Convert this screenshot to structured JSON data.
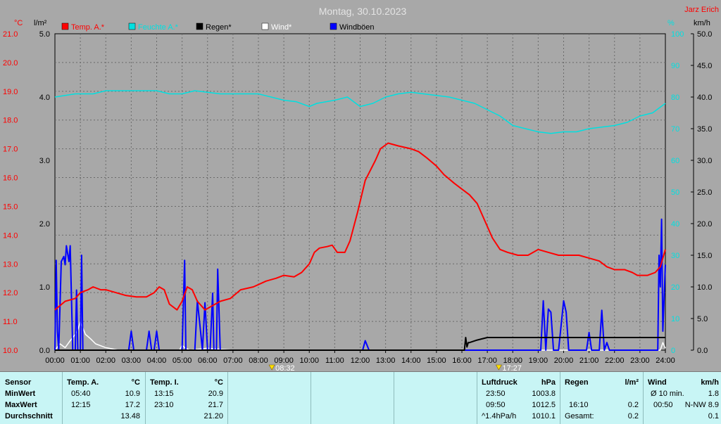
{
  "chart_data": {
    "type": "line",
    "title": "Montag, 30.10.2023",
    "brand": "Jarz Erich",
    "axes": {
      "temp": {
        "unit": "°C",
        "min": 10.0,
        "max": 21.0,
        "step": 1.0,
        "color": "#ff0000"
      },
      "rain": {
        "unit": "l/m²",
        "min": 0.0,
        "max": 5.0,
        "step": 1.0,
        "color": "#000000"
      },
      "humidity": {
        "unit": "%",
        "min": 0,
        "max": 100,
        "step": 10,
        "color": "#00e0e0"
      },
      "wind": {
        "unit": "km/h",
        "min": 0.0,
        "max": 50.0,
        "step": 5.0,
        "color": "#000000"
      }
    },
    "x_ticks": [
      "00:00",
      "01:00",
      "02:00",
      "03:00",
      "04:00",
      "05:00",
      "06:00",
      "07:00",
      "08:00",
      "09:00",
      "10:00",
      "11:00",
      "12:00",
      "13:00",
      "14:00",
      "15:00",
      "16:00",
      "17:00",
      "18:00",
      "19:00",
      "20:00",
      "21:00",
      "22:00",
      "23:00",
      "24:00"
    ],
    "sun_markers": [
      {
        "label": "08:32",
        "hour": 8.53
      },
      {
        "label": "17:27",
        "hour": 17.45
      }
    ],
    "grid": true,
    "legend_position": "top",
    "series": [
      {
        "name": "Temp. A.*",
        "key": "temp",
        "axis": "temp",
        "color": "#ff0000",
        "x": [
          0,
          0.4,
          0.8,
          1.0,
          1.3,
          1.5,
          1.8,
          2.0,
          2.4,
          2.8,
          3.2,
          3.6,
          3.9,
          4.1,
          4.3,
          4.5,
          4.8,
          5.0,
          5.2,
          5.4,
          5.6,
          5.9,
          6.1,
          6.5,
          6.9,
          7.3,
          7.8,
          8.3,
          8.7,
          9.0,
          9.4,
          9.7,
          10.0,
          10.2,
          10.4,
          10.7,
          10.9,
          11.1,
          11.4,
          11.6,
          11.9,
          12.2,
          12.6,
          12.8,
          13.1,
          13.5,
          14.0,
          14.3,
          14.6,
          15.0,
          15.3,
          15.7,
          16.0,
          16.3,
          16.6,
          16.9,
          17.2,
          17.5,
          17.8,
          18.2,
          18.6,
          19.0,
          19.4,
          19.8,
          20.2,
          20.6,
          21.0,
          21.4,
          21.7,
          22.0,
          22.4,
          22.7,
          22.9,
          23.3,
          23.6,
          23.8,
          24.0
        ],
        "y": [
          11.4,
          11.7,
          11.8,
          12.0,
          12.1,
          12.2,
          12.1,
          12.1,
          12.0,
          11.9,
          11.85,
          11.85,
          12.0,
          12.2,
          12.1,
          11.6,
          11.4,
          11.7,
          12.2,
          12.1,
          11.7,
          11.4,
          11.5,
          11.7,
          11.8,
          12.1,
          12.2,
          12.4,
          12.5,
          12.6,
          12.55,
          12.7,
          13.0,
          13.4,
          13.55,
          13.6,
          13.65,
          13.4,
          13.4,
          13.8,
          14.8,
          15.9,
          16.6,
          17.0,
          17.2,
          17.1,
          17.0,
          16.9,
          16.7,
          16.4,
          16.1,
          15.8,
          15.6,
          15.4,
          15.1,
          14.5,
          13.9,
          13.5,
          13.4,
          13.3,
          13.3,
          13.5,
          13.4,
          13.3,
          13.3,
          13.3,
          13.2,
          13.1,
          12.9,
          12.8,
          12.8,
          12.7,
          12.6,
          12.6,
          12.7,
          12.9,
          13.5
        ]
      },
      {
        "name": "Feuchte A.*",
        "key": "humidity",
        "axis": "humidity",
        "color": "#00e0e0",
        "x": [
          0,
          0.8,
          1.5,
          2.0,
          3.0,
          3.5,
          4.0,
          4.5,
          5.0,
          5.5,
          6.0,
          6.5,
          7.0,
          7.5,
          8.0,
          8.5,
          9.0,
          9.5,
          10.0,
          10.3,
          11.0,
          11.5,
          12.0,
          12.5,
          13.0,
          13.5,
          14.0,
          14.5,
          15.0,
          15.5,
          16.0,
          16.5,
          17.0,
          17.5,
          18.0,
          18.5,
          19.0,
          19.5,
          20.0,
          20.5,
          21.0,
          21.5,
          22.0,
          22.5,
          23.0,
          23.5,
          24.0
        ],
        "y": [
          80,
          81,
          81,
          82,
          82,
          82,
          82,
          81,
          81,
          82,
          81.5,
          81,
          81,
          81,
          81,
          80,
          79,
          78.5,
          77,
          78,
          79,
          80,
          77,
          78,
          80,
          81,
          81.5,
          81,
          80.5,
          80,
          79,
          78,
          76,
          74,
          71,
          70,
          69,
          68.5,
          69,
          69,
          70,
          70.5,
          71,
          72,
          74,
          75,
          78
        ]
      },
      {
        "name": "Regen*",
        "key": "rain",
        "axis": "rain",
        "color": "#000000",
        "x": [
          0,
          16.1,
          16.15,
          16.2,
          16.25,
          16.3,
          16.6,
          17.0,
          17.5,
          18.0,
          24.0
        ],
        "y": [
          0,
          0,
          0.2,
          0.05,
          0.12,
          0.12,
          0.16,
          0.2,
          0.2,
          0.2,
          0.2
        ]
      },
      {
        "name": "Wind*",
        "key": "wind",
        "axis": "wind",
        "color": "#ffffff",
        "x": [
          0,
          0.2,
          0.4,
          0.6,
          0.8,
          0.9,
          1.0,
          1.1,
          1.2,
          1.4,
          1.6,
          2.0,
          2.5,
          4.9,
          5.0,
          5.1,
          5.3,
          6.0,
          7.0,
          22.0,
          23.8,
          23.9,
          24.0
        ],
        "y": [
          0,
          1.0,
          0.4,
          1.5,
          2.5,
          3.2,
          4.5,
          3.5,
          2.5,
          1.8,
          1.0,
          0.4,
          0,
          0,
          0.8,
          0.4,
          0,
          0.3,
          0,
          0,
          0,
          1.2,
          0.3
        ]
      },
      {
        "name": "Windböen",
        "key": "gusts",
        "axis": "wind",
        "color": "#0000ff",
        "x": [
          0,
          0.05,
          0.1,
          0.15,
          0.25,
          0.35,
          0.4,
          0.45,
          0.55,
          0.6,
          0.7,
          0.8,
          0.85,
          0.9,
          1.0,
          1.05,
          1.1,
          1.15,
          1.2,
          1.3,
          1.5,
          1.6,
          1.7,
          2.0,
          2.1,
          2.2,
          2.35,
          2.5,
          2.9,
          3.0,
          3.1,
          3.2,
          3.6,
          3.7,
          3.8,
          3.9,
          4.0,
          4.1,
          4.2,
          5.0,
          5.1,
          5.15,
          5.2,
          5.3,
          5.5,
          5.6,
          5.7,
          5.8,
          5.9,
          6.0,
          6.1,
          6.2,
          6.25,
          6.3,
          6.35,
          6.4,
          6.5,
          11.0,
          12.1,
          12.2,
          12.35,
          12.5,
          19.1,
          19.2,
          19.3,
          19.4,
          19.5,
          19.6,
          19.7,
          19.8,
          20.0,
          20.1,
          20.2,
          20.3,
          20.4,
          20.5,
          20.9,
          21.0,
          21.1,
          21.4,
          21.5,
          21.6,
          21.7,
          21.8,
          21.9,
          22.0,
          23.6,
          23.7,
          23.75,
          23.8,
          23.85,
          23.9,
          24.0
        ],
        "y": [
          0,
          14.2,
          3.0,
          0,
          14.0,
          14.8,
          13.5,
          16.5,
          14.0,
          16.5,
          0,
          0,
          9.5,
          0,
          0,
          15.0,
          0,
          0,
          0,
          0,
          0,
          0,
          0,
          0,
          0,
          0,
          0,
          0,
          0,
          3.0,
          0,
          0,
          0,
          3.0,
          0,
          0,
          3.0,
          0,
          0,
          0,
          14.2,
          0,
          0,
          0,
          0,
          7.8,
          4.0,
          0,
          7.5,
          0,
          0,
          9.0,
          0,
          0,
          0,
          12.8,
          0,
          0,
          0,
          1.5,
          0,
          0,
          0,
          7.8,
          0,
          6.5,
          6.0,
          0,
          0,
          0,
          7.8,
          6.0,
          0,
          0,
          0,
          0,
          0,
          2.8,
          0,
          0,
          6.3,
          0,
          1.2,
          0,
          0,
          0,
          0,
          0,
          15.0,
          10.0,
          20.7,
          3.0,
          13.5
        ]
      }
    ]
  },
  "table": {
    "c1": {
      "h": "Sensor",
      "r1": "MinWert",
      "r2": "MaxWert",
      "r3": "Durchschnitt"
    },
    "c2": {
      "h": "Temp. A.",
      "u": "°C",
      "r1t": "05:40",
      "r1v": "10.9",
      "r2t": "12:15",
      "r2v": "17.2",
      "r3v": "13.48"
    },
    "c3": {
      "h": "Temp. I.",
      "u": "°C",
      "r1t": "13:15",
      "r1v": "20.9",
      "r2t": "23:10",
      "r2v": "21.7",
      "r3v": "21.20"
    },
    "c4": {
      "h": "Luftdruck",
      "u": "hPa",
      "r1t": "23:50",
      "r1v": "1003.8",
      "r2t": "09:50",
      "r2v": "1012.5",
      "r3t": "^1.4hPa/h",
      "r3v": "1010.1"
    },
    "c5": {
      "h": "Regen",
      "u": "l/m²",
      "r2t": "16:10",
      "r2v": "0.2",
      "r3t": "Gesamt:",
      "r3v": "0.2"
    },
    "c6": {
      "h": "Wind",
      "u": "km/h",
      "r1t": "Ø 10 min.",
      "r1v": "1.8",
      "r2t": "00:50",
      "r2v": "N-NW 8.9",
      "r3v": "0.1"
    }
  }
}
